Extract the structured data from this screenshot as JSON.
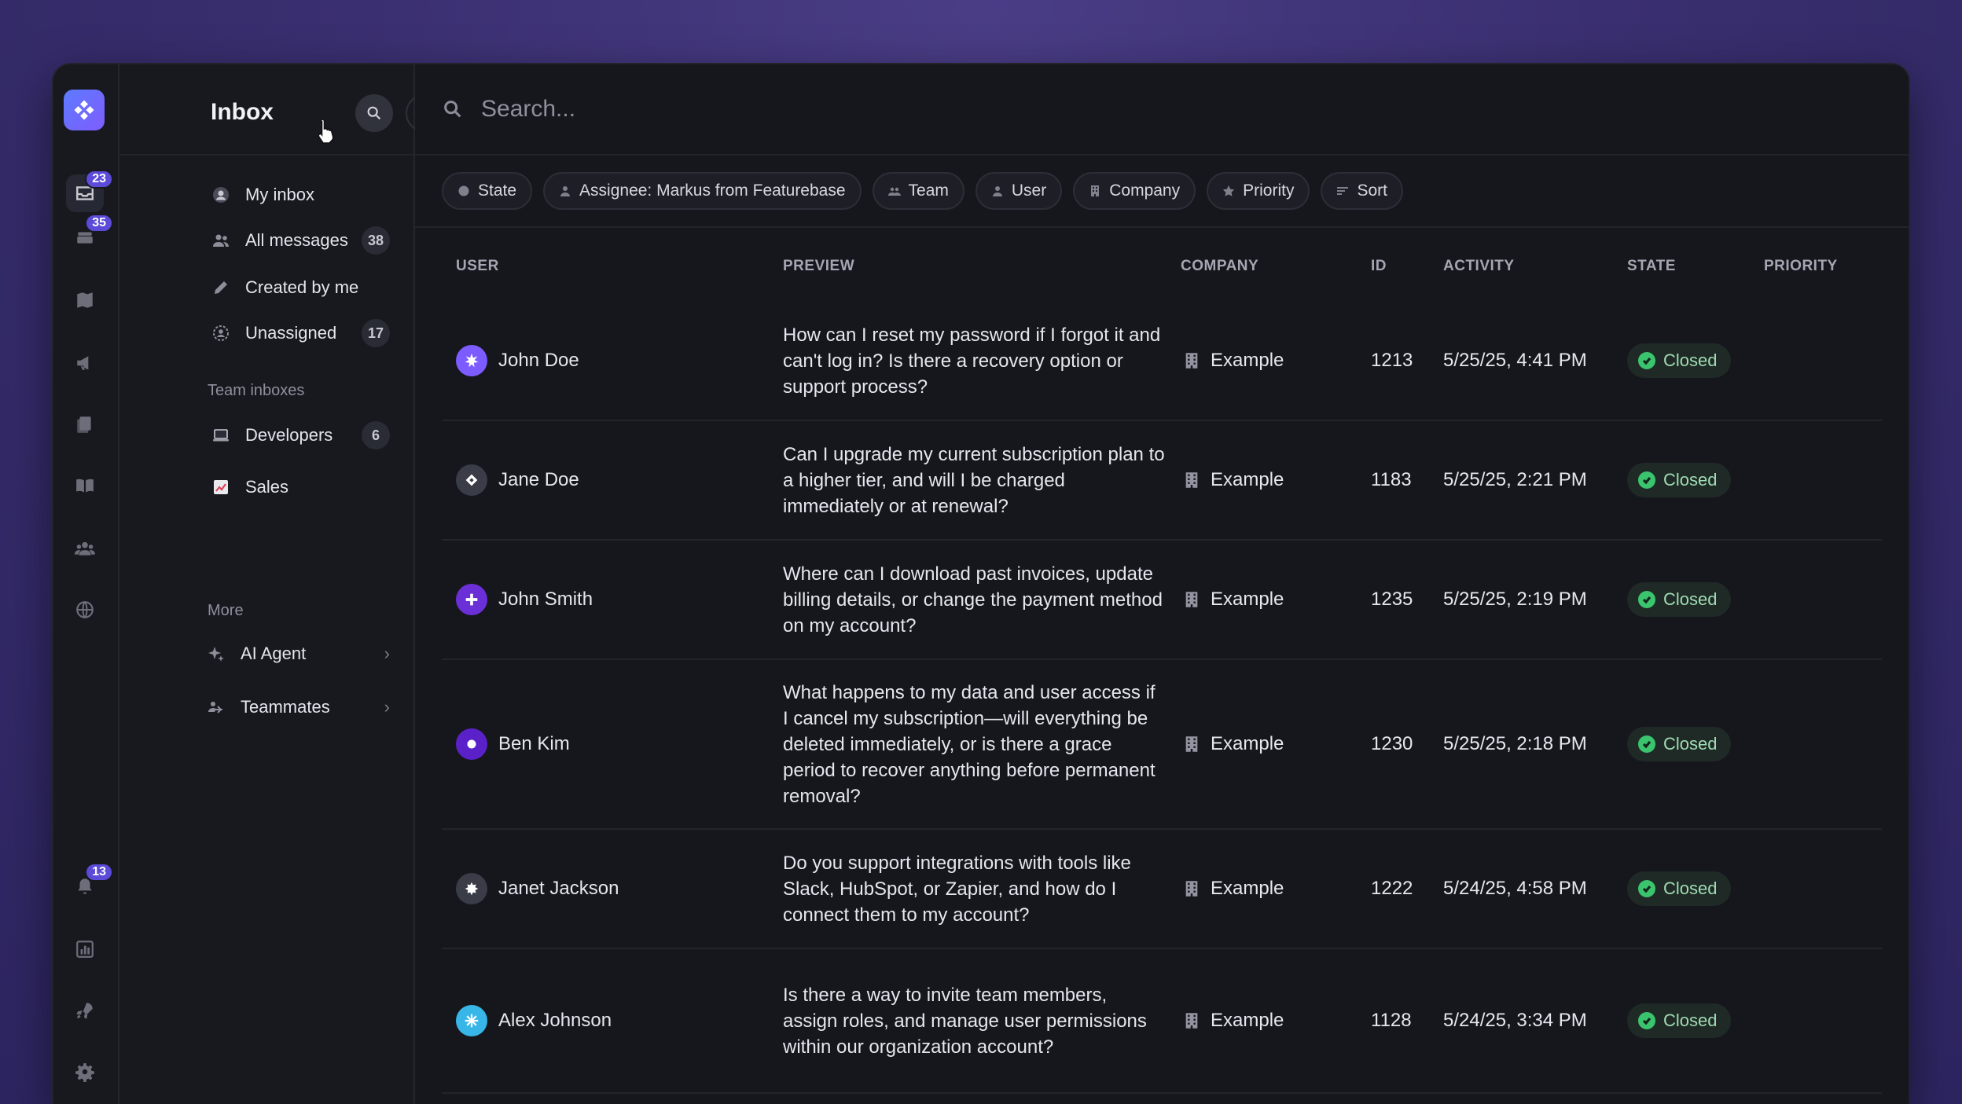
{
  "rail": {
    "badges": {
      "inbox": "23",
      "tickets": "35",
      "notifications": "13"
    }
  },
  "panel": {
    "title": "Inbox",
    "items": [
      {
        "label": "My inbox",
        "count": ""
      },
      {
        "label": "All messages",
        "count": "38"
      },
      {
        "label": "Created by me",
        "count": ""
      },
      {
        "label": "Unassigned",
        "count": "17"
      }
    ],
    "team_label": "Team inboxes",
    "team_items": [
      {
        "label": "Developers",
        "count": "6"
      },
      {
        "label": "Sales",
        "count": ""
      }
    ],
    "more_label": "More",
    "more_items": [
      {
        "label": "AI Agent"
      },
      {
        "label": "Teammates"
      }
    ]
  },
  "search": {
    "placeholder": "Search..."
  },
  "filters": [
    "State",
    "Assignee: Markus from Featurebase",
    "Team",
    "User",
    "Company",
    "Priority",
    "Sort"
  ],
  "table": {
    "headers": [
      "USER",
      "PREVIEW",
      "COMPANY",
      "ID",
      "ACTIVITY",
      "STATE",
      "PRIORITY"
    ],
    "rows": [
      {
        "user": "John Doe",
        "preview": "How can I reset my password if I forgot it and can't log in? Is there a recovery option or support process?",
        "company": "Example",
        "id": "1213",
        "activity": "5/25/25, 4:41 PM",
        "state": "Closed",
        "avatar_color": "#7c5cff"
      },
      {
        "user": "Jane Doe",
        "preview": "Can I upgrade my current subscription plan to a higher tier, and will I be charged immediately or at renewal?",
        "company": "Example",
        "id": "1183",
        "activity": "5/25/25, 2:21 PM",
        "state": "Closed",
        "avatar_color": "#3a3c48"
      },
      {
        "user": "John Smith",
        "preview": "Where can I download past invoices, update billing details, or change the payment method on my account?",
        "company": "Example",
        "id": "1235",
        "activity": "5/25/25, 2:19 PM",
        "state": "Closed",
        "avatar_color": "#6a2fd6"
      },
      {
        "user": "Ben Kim",
        "preview": "What happens to my data and user access if I cancel my subscription—will everything be deleted immediately, or is there a grace period to recover anything before permanent removal?",
        "company": "Example",
        "id": "1230",
        "activity": "5/25/25, 2:18 PM",
        "state": "Closed",
        "avatar_color": "#5b21c9"
      },
      {
        "user": "Janet Jackson",
        "preview": "Do you support integrations with tools like Slack, HubSpot, or Zapier, and how do I connect them to my account?",
        "company": "Example",
        "id": "1222",
        "activity": "5/24/25, 4:58 PM",
        "state": "Closed",
        "avatar_color": "#3a3c48"
      },
      {
        "user": "Alex Johnson",
        "preview": "Is there a way to invite team members, assign roles, and manage user permissions within our organization account?",
        "company": "Example",
        "id": "1128",
        "activity": "5/24/25, 3:34 PM",
        "state": "Closed",
        "avatar_color": "#38b6e8"
      }
    ]
  }
}
